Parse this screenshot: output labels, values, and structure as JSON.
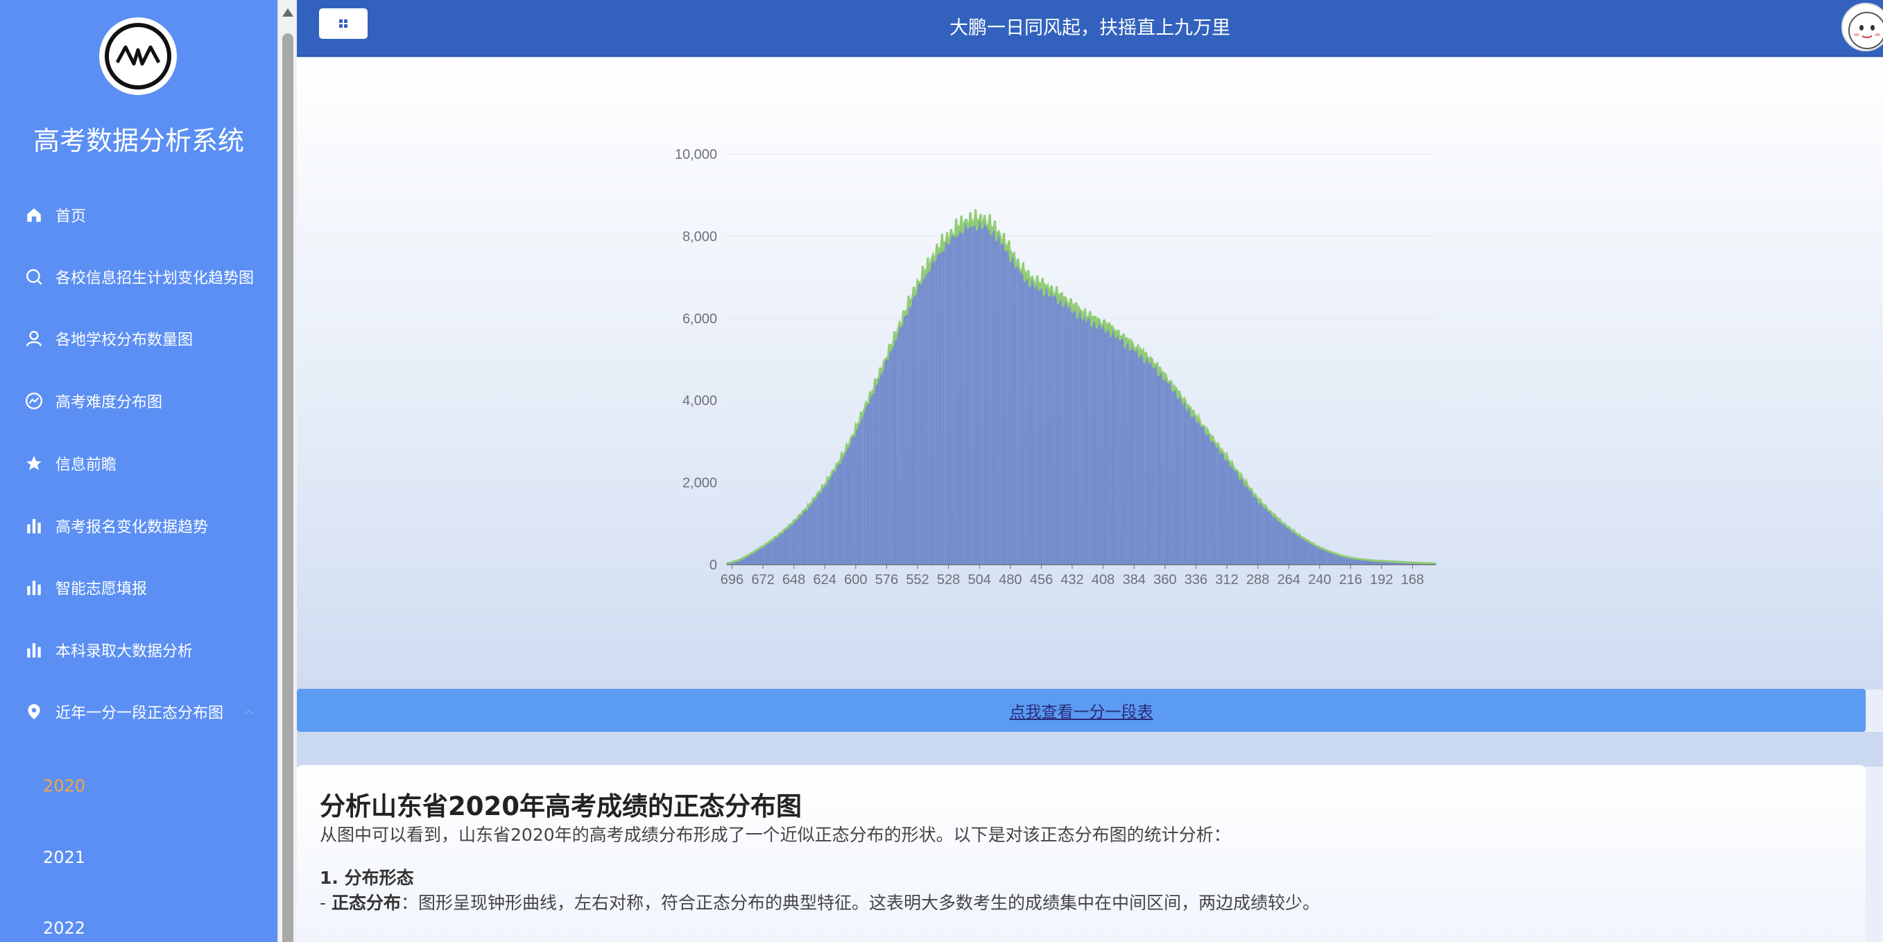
{
  "sidebar": {
    "title": "高考数据分析系统",
    "items": [
      {
        "label": "首页",
        "icon": "home-icon"
      },
      {
        "label": "各校信息招生计划变化趋势图",
        "icon": "search-icon"
      },
      {
        "label": "各地学校分布数量图",
        "icon": "user-icon"
      },
      {
        "label": "高考难度分布图",
        "icon": "smile-chart-icon"
      },
      {
        "label": "信息前瞻",
        "icon": "star-icon"
      },
      {
        "label": "高考报名变化数据趋势",
        "icon": "bar-chart-icon"
      },
      {
        "label": "智能志愿填报",
        "icon": "bar-chart-icon"
      },
      {
        "label": "本科录取大数据分析",
        "icon": "bar-chart-icon"
      },
      {
        "label": "近年一分一段正态分布图",
        "icon": "location-icon"
      }
    ],
    "sub_items": [
      {
        "label": "2020",
        "active": true
      },
      {
        "label": "2021",
        "active": false
      },
      {
        "label": "2022",
        "active": false
      }
    ],
    "colors": {
      "background": "#5b8ff3",
      "active": "#f5a742"
    }
  },
  "header": {
    "slogan": "大鹏一日同风起，扶摇直上九万里",
    "background": "#3262bd"
  },
  "chart_data": {
    "type": "bar",
    "overlay": "line",
    "x_axis_order": "descending score",
    "x_tick_labels": [
      "696",
      "672",
      "648",
      "624",
      "600",
      "576",
      "552",
      "528",
      "504",
      "480",
      "456",
      "432",
      "408",
      "384",
      "360",
      "336",
      "312",
      "288",
      "264",
      "240",
      "216",
      "192",
      "168"
    ],
    "y_tick_labels": [
      "0",
      "2,000",
      "4,000",
      "6,000",
      "8,000",
      "10,000"
    ],
    "ylim": [
      0,
      10000
    ],
    "xlim": [
      150,
      700
    ],
    "grid": "horizontal",
    "bar_color": "#6a84c8",
    "line_color": "#91cc75",
    "series": [
      {
        "x": [
          700,
          696,
          690,
          684,
          678,
          672,
          666,
          660,
          654,
          648,
          642,
          636,
          630,
          624,
          618,
          612,
          606,
          600,
          594,
          588,
          582,
          576,
          570,
          564,
          558,
          552,
          546,
          540,
          534,
          528,
          522,
          516,
          510,
          504,
          498,
          492,
          486,
          480,
          474,
          468,
          462,
          456,
          450,
          444,
          438,
          432,
          426,
          420,
          414,
          408,
          402,
          396,
          390,
          384,
          378,
          372,
          366,
          360,
          354,
          348,
          342,
          336,
          330,
          324,
          318,
          312,
          306,
          300,
          294,
          288,
          282,
          276,
          270,
          264,
          258,
          252,
          246,
          240,
          234,
          228,
          222,
          216,
          210,
          204,
          198,
          192,
          186,
          180,
          174,
          168,
          162,
          156,
          150
        ],
        "y": [
          30,
          60,
          120,
          220,
          330,
          450,
          580,
          720,
          880,
          1050,
          1250,
          1450,
          1700,
          1950,
          2250,
          2550,
          2900,
          3300,
          3750,
          4150,
          4600,
          5050,
          5500,
          5950,
          6400,
          6800,
          7150,
          7450,
          7750,
          7950,
          8150,
          8300,
          8350,
          8380,
          8320,
          8150,
          7900,
          7600,
          7300,
          7050,
          6900,
          6800,
          6700,
          6580,
          6450,
          6300,
          6150,
          6050,
          5950,
          5850,
          5750,
          5600,
          5450,
          5300,
          5150,
          5000,
          4800,
          4580,
          4350,
          4100,
          3850,
          3600,
          3350,
          3100,
          2850,
          2600,
          2350,
          2100,
          1850,
          1600,
          1400,
          1220,
          1050,
          900,
          760,
          630,
          520,
          420,
          340,
          270,
          210,
          170,
          140,
          120,
          100,
          90,
          80,
          70,
          60,
          50,
          40,
          35,
          30
        ]
      }
    ]
  },
  "table_link": {
    "label": "点我查看一分一段表"
  },
  "analysis": {
    "title": "分析山东省2020年高考成绩的正态分布图",
    "intro": "从图中可以看到，山东省2020年的高考成绩分布形成了一个近似正态分布的形状。以下是对该正态分布图的统计分析：",
    "section1_title": "1. 分布形态",
    "section1_prefix": "- ",
    "section1_bold": "正态分布",
    "section1_text": "：图形呈现钟形曲线，左右对称，符合正态分布的典型特征。这表明大多数考生的成绩集中在中间区间，两边成绩较少。"
  }
}
